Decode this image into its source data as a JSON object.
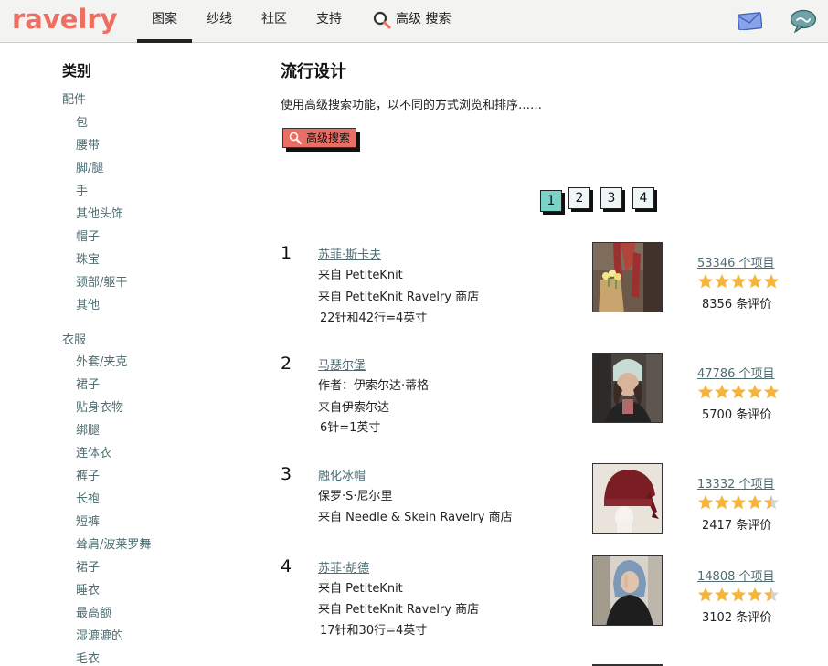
{
  "header": {
    "logo": "ravelry",
    "nav": [
      "图案",
      "纱线",
      "社区",
      "支持"
    ],
    "search_label": "高级 搜索"
  },
  "sidebar": {
    "title": "类别",
    "groups": [
      {
        "name": "配件",
        "items": [
          "包",
          "腰带",
          "脚/腿",
          "手",
          "其他头饰",
          "帽子",
          "珠宝",
          "颈部/躯干",
          "其他"
        ]
      },
      {
        "name": "衣服",
        "items": [
          "外套/夹克",
          "裙子",
          "贴身衣物",
          "绑腿",
          "连体衣",
          "裤子",
          "长袍",
          "短裤",
          "耸肩/波莱罗舞",
          "裙子",
          "睡衣",
          "最高额",
          "湿漉漉的",
          "毛衣"
        ]
      }
    ]
  },
  "main": {
    "title": "流行设计",
    "description": "使用高级搜索功能，以不同的方式浏览和排序……",
    "adv_search_button": "高级搜索",
    "pages": [
      "1",
      "2",
      "3",
      "4"
    ],
    "current_page": "1"
  },
  "patterns": [
    {
      "rank": "1",
      "title": "苏菲·斯卡夫",
      "lines": [
        "来自 PetiteKnit",
        "来自 PetiteKnit Ravelry 商店"
      ],
      "gauge": "22针和42行=4英寸",
      "projects": "53346 个项目",
      "rating": 5,
      "reviews": "8356 条评价"
    },
    {
      "rank": "2",
      "title": "马瑟尔堡",
      "lines": [
        "作者：伊索尔达·蒂格",
        "来自伊索尔达"
      ],
      "gauge": "6针=1英寸",
      "projects": "47786 个项目",
      "rating": 5,
      "reviews": "5700 条评价"
    },
    {
      "rank": "3",
      "title": "融化冰帽",
      "lines": [
        "保罗·S·尼尔里",
        "来自 Needle & Skein Ravelry 商店"
      ],
      "gauge": "",
      "projects": "13332 个项目",
      "rating": 4.5,
      "reviews": "2417 条评价"
    },
    {
      "rank": "4",
      "title": "苏菲·胡德",
      "lines": [
        "来自 PetiteKnit",
        "来自 PetiteKnit Ravelry 商店"
      ],
      "gauge": "17针和30行=4英寸",
      "projects": "14808 个项目",
      "rating": 4.5,
      "reviews": "3102 条评价"
    }
  ],
  "colors": {
    "brand": "#ee6e62",
    "link": "#4f6d72",
    "page_current": "#7cd2c6",
    "star": "#f5b53b"
  },
  "icons": {
    "nav_search": "search-icon",
    "mail": "mail-icon",
    "chat": "chat-bubble-icon",
    "rating": "star-icon"
  }
}
